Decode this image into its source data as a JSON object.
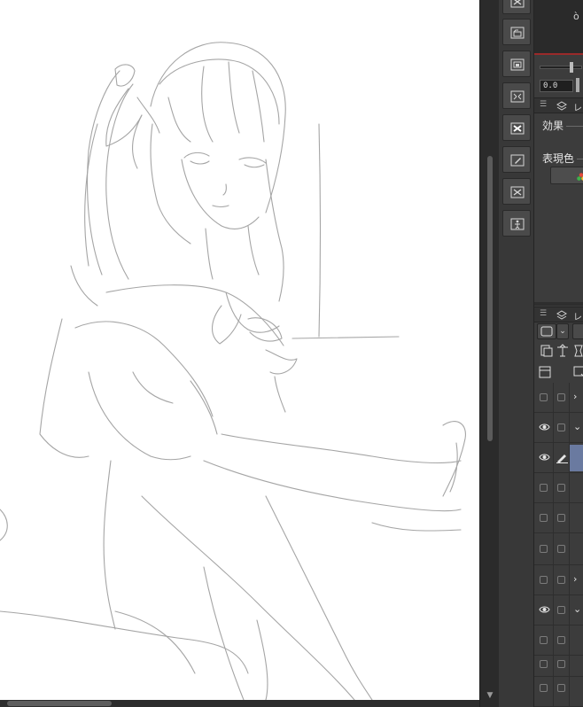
{
  "panels": {
    "preview_glyph": "ò",
    "property_value": "0.0",
    "subtool_tab_label": "レ",
    "effect_label": "効果",
    "expression_color_label": "表現色",
    "layer_tab_label": "レ"
  },
  "layers": [
    {
      "visible": false,
      "kind": "folder",
      "chevron": "›"
    },
    {
      "visible": true,
      "kind": "folder-open",
      "chevron": "⌄"
    },
    {
      "visible": true,
      "kind": "raster-selected",
      "chevron": ""
    },
    {
      "visible": false,
      "kind": "raster",
      "chevron": ""
    },
    {
      "visible": false,
      "kind": "raster",
      "chevron": ""
    },
    {
      "visible": false,
      "kind": "raster",
      "chevron": ""
    },
    {
      "visible": false,
      "kind": "folder",
      "chevron": "›"
    },
    {
      "visible": true,
      "kind": "folder-open",
      "chevron": "⌄"
    },
    {
      "visible": false,
      "kind": "raster",
      "chevron": ""
    },
    {
      "visible": false,
      "kind": "raster",
      "chevron": ""
    },
    {
      "visible": false,
      "kind": "raster",
      "chevron": ""
    }
  ],
  "colors": {
    "canvas": "#ffffff",
    "sketch_line": "#9c9c9c",
    "panel_bg": "#3c3c3c",
    "selected_layer": "#6a7aa0",
    "accent_red": "#9a2a2a"
  },
  "toolstrip_icons": [
    "delete-icon",
    "folder-layer-icon",
    "layer-mask-icon",
    "transform-icon",
    "clear-icon",
    "edit-layer-icon",
    "delete-layer-icon",
    "person-figure-icon"
  ]
}
